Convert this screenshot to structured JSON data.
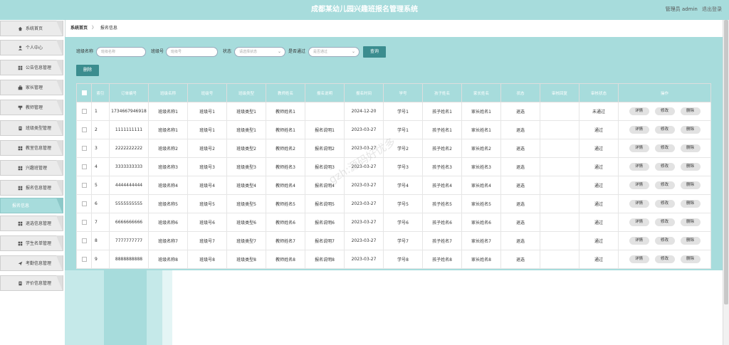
{
  "app": {
    "title": "成都某幼儿园兴趣班报名管理系统"
  },
  "user": {
    "label": "管理员 admin",
    "logout": "退出登录"
  },
  "sidebar": {
    "items": [
      {
        "label": "系统首页",
        "icon": "home-icon"
      },
      {
        "label": "个人中心",
        "icon": "user-icon"
      },
      {
        "label": "公告信息管理",
        "icon": "grid-icon"
      },
      {
        "label": "家长管理",
        "icon": "bag-icon"
      },
      {
        "label": "教师管理",
        "icon": "teacher-icon"
      },
      {
        "label": "班级类型管理",
        "icon": "doc-icon"
      },
      {
        "label": "教室信息管理",
        "icon": "grid-icon"
      },
      {
        "label": "兴趣班管理",
        "icon": "grid-icon"
      },
      {
        "label": "报名信息管理",
        "icon": "grid-icon"
      },
      {
        "label": "报名信息",
        "icon": "",
        "active": true
      },
      {
        "label": "退选信息管理",
        "icon": "grid-icon"
      },
      {
        "label": "学生名单管理",
        "icon": "grid-icon"
      },
      {
        "label": "考勤信息管理",
        "icon": "send-icon"
      },
      {
        "label": "评价信息管理",
        "icon": "doc-icon"
      }
    ]
  },
  "breadcrumb": {
    "home": "系统首页",
    "sep": "〉",
    "current": "报名信息"
  },
  "search": {
    "class_name_label": "班级名称",
    "class_name_placeholder": "班级名称",
    "class_no_label": "班级号",
    "class_no_placeholder": "班级号",
    "status_label": "状态",
    "status_placeholder": "请选择状态",
    "approved_label": "是否通过",
    "approved_placeholder": "是否通过",
    "query_button": "查询"
  },
  "delete_button": "删除",
  "table": {
    "headers": [
      "索引",
      "订单编号",
      "班级名称",
      "班级号",
      "班级类型",
      "教师姓名",
      "报名说明",
      "报名时间",
      "学号",
      "孩子姓名",
      "家长姓名",
      "状态",
      "审核回复",
      "审核状态",
      "操作"
    ],
    "actions": {
      "detail": "详情",
      "edit": "修改",
      "delete": "删除"
    },
    "rows": [
      [
        "1",
        "1734667946918",
        "班级名称1",
        "班级号1",
        "班级类型1",
        "教师姓名1",
        "",
        "2024-12-20",
        "学号1",
        "孩子姓名1",
        "家长姓名1",
        "退选",
        "",
        "未通过"
      ],
      [
        "2",
        "1111111111",
        "班级名称1",
        "班级号1",
        "班级类型1",
        "教师姓名1",
        "报名说明1",
        "2023-03-27",
        "学号1",
        "孩子姓名1",
        "家长姓名1",
        "退选",
        "",
        "通过"
      ],
      [
        "3",
        "2222222222",
        "班级名称2",
        "班级号2",
        "班级类型2",
        "教师姓名2",
        "报名说明2",
        "2023-03-27",
        "学号2",
        "孩子姓名2",
        "家长姓名2",
        "退选",
        "",
        "通过"
      ],
      [
        "4",
        "3333333333",
        "班级名称3",
        "班级号3",
        "班级类型3",
        "教师姓名3",
        "报名说明3",
        "2023-03-27",
        "学号3",
        "孩子姓名3",
        "家长姓名3",
        "退选",
        "",
        "通过"
      ],
      [
        "5",
        "4444444444",
        "班级名称4",
        "班级号4",
        "班级类型4",
        "教师姓名4",
        "报名说明4",
        "2023-03-27",
        "学号4",
        "孩子姓名4",
        "家长姓名4",
        "退选",
        "",
        "通过"
      ],
      [
        "6",
        "5555555555",
        "班级名称5",
        "班级号5",
        "班级类型5",
        "教师姓名5",
        "报名说明5",
        "2023-03-27",
        "学号5",
        "孩子姓名5",
        "家长姓名5",
        "退选",
        "",
        "通过"
      ],
      [
        "7",
        "6666666666",
        "班级名称6",
        "班级号6",
        "班级类型6",
        "教师姓名6",
        "报名说明6",
        "2023-03-27",
        "学号6",
        "孩子姓名6",
        "家长姓名6",
        "退选",
        "",
        "通过"
      ],
      [
        "8",
        "7777777777",
        "班级名称7",
        "班级号7",
        "班级类型7",
        "教师姓名7",
        "报名说明7",
        "2023-03-27",
        "学号7",
        "孩子姓名7",
        "家长姓名7",
        "退选",
        "",
        "通过"
      ],
      [
        "9",
        "8888888888",
        "班级名称8",
        "班级号8",
        "班级类型8",
        "教师姓名8",
        "报名说明8",
        "2023-03-27",
        "学号8",
        "孩子姓名8",
        "家长姓名8",
        "退选",
        "",
        "通过"
      ]
    ]
  },
  "watermark": "gzh:源码好优多",
  "colors": {
    "accent": "#a7dcdc",
    "button": "#3b8d8f"
  }
}
